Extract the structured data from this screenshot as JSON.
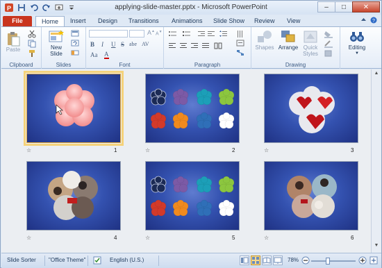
{
  "window": {
    "title": "applying-slide-master.pptx - Microsoft PowerPoint",
    "app_icon": "powerpoint-icon"
  },
  "qat": {
    "items": [
      "save-icon",
      "undo-icon",
      "redo-icon",
      "slideshow-from-start-icon",
      "customize-qat-icon"
    ]
  },
  "tabs": [
    "File",
    "Home",
    "Insert",
    "Design",
    "Transitions",
    "Animations",
    "Slide Show",
    "Review",
    "View"
  ],
  "active_tab": "Home",
  "ribbon": {
    "clipboard": {
      "label": "Clipboard",
      "paste": "Paste"
    },
    "slides": {
      "label": "Slides",
      "new_slide": "New\nSlide"
    },
    "font": {
      "label": "Font",
      "bold": "B",
      "italic": "I",
      "underline": "U",
      "strike": "S",
      "shadow": "abe",
      "spacing": "AV",
      "case": "Aa",
      "color": "A"
    },
    "paragraph": {
      "label": "Paragraph"
    },
    "drawing": {
      "label": "Drawing",
      "shapes": "Shapes",
      "arrange": "Arrange",
      "quick_styles": "Quick\nStyles"
    },
    "editing": {
      "label": "",
      "editing": "Editing"
    }
  },
  "slides": [
    {
      "number": "1",
      "selected": true
    },
    {
      "number": "2",
      "selected": false
    },
    {
      "number": "3",
      "selected": false
    },
    {
      "number": "4",
      "selected": false
    },
    {
      "number": "5",
      "selected": false
    },
    {
      "number": "6",
      "selected": false
    }
  ],
  "clover_colors": [
    "#1b2a55",
    "#7c5aa6",
    "#1c9fb8",
    "#8cc63f",
    "#d23a2a",
    "#f08a1e",
    "#2f6fb8",
    "#ffffff"
  ],
  "status": {
    "view": "Slide Sorter",
    "theme": "\"Office Theme\"",
    "language": "English (U.S.)",
    "zoom": "78%",
    "zoom_fraction": 0.78
  }
}
